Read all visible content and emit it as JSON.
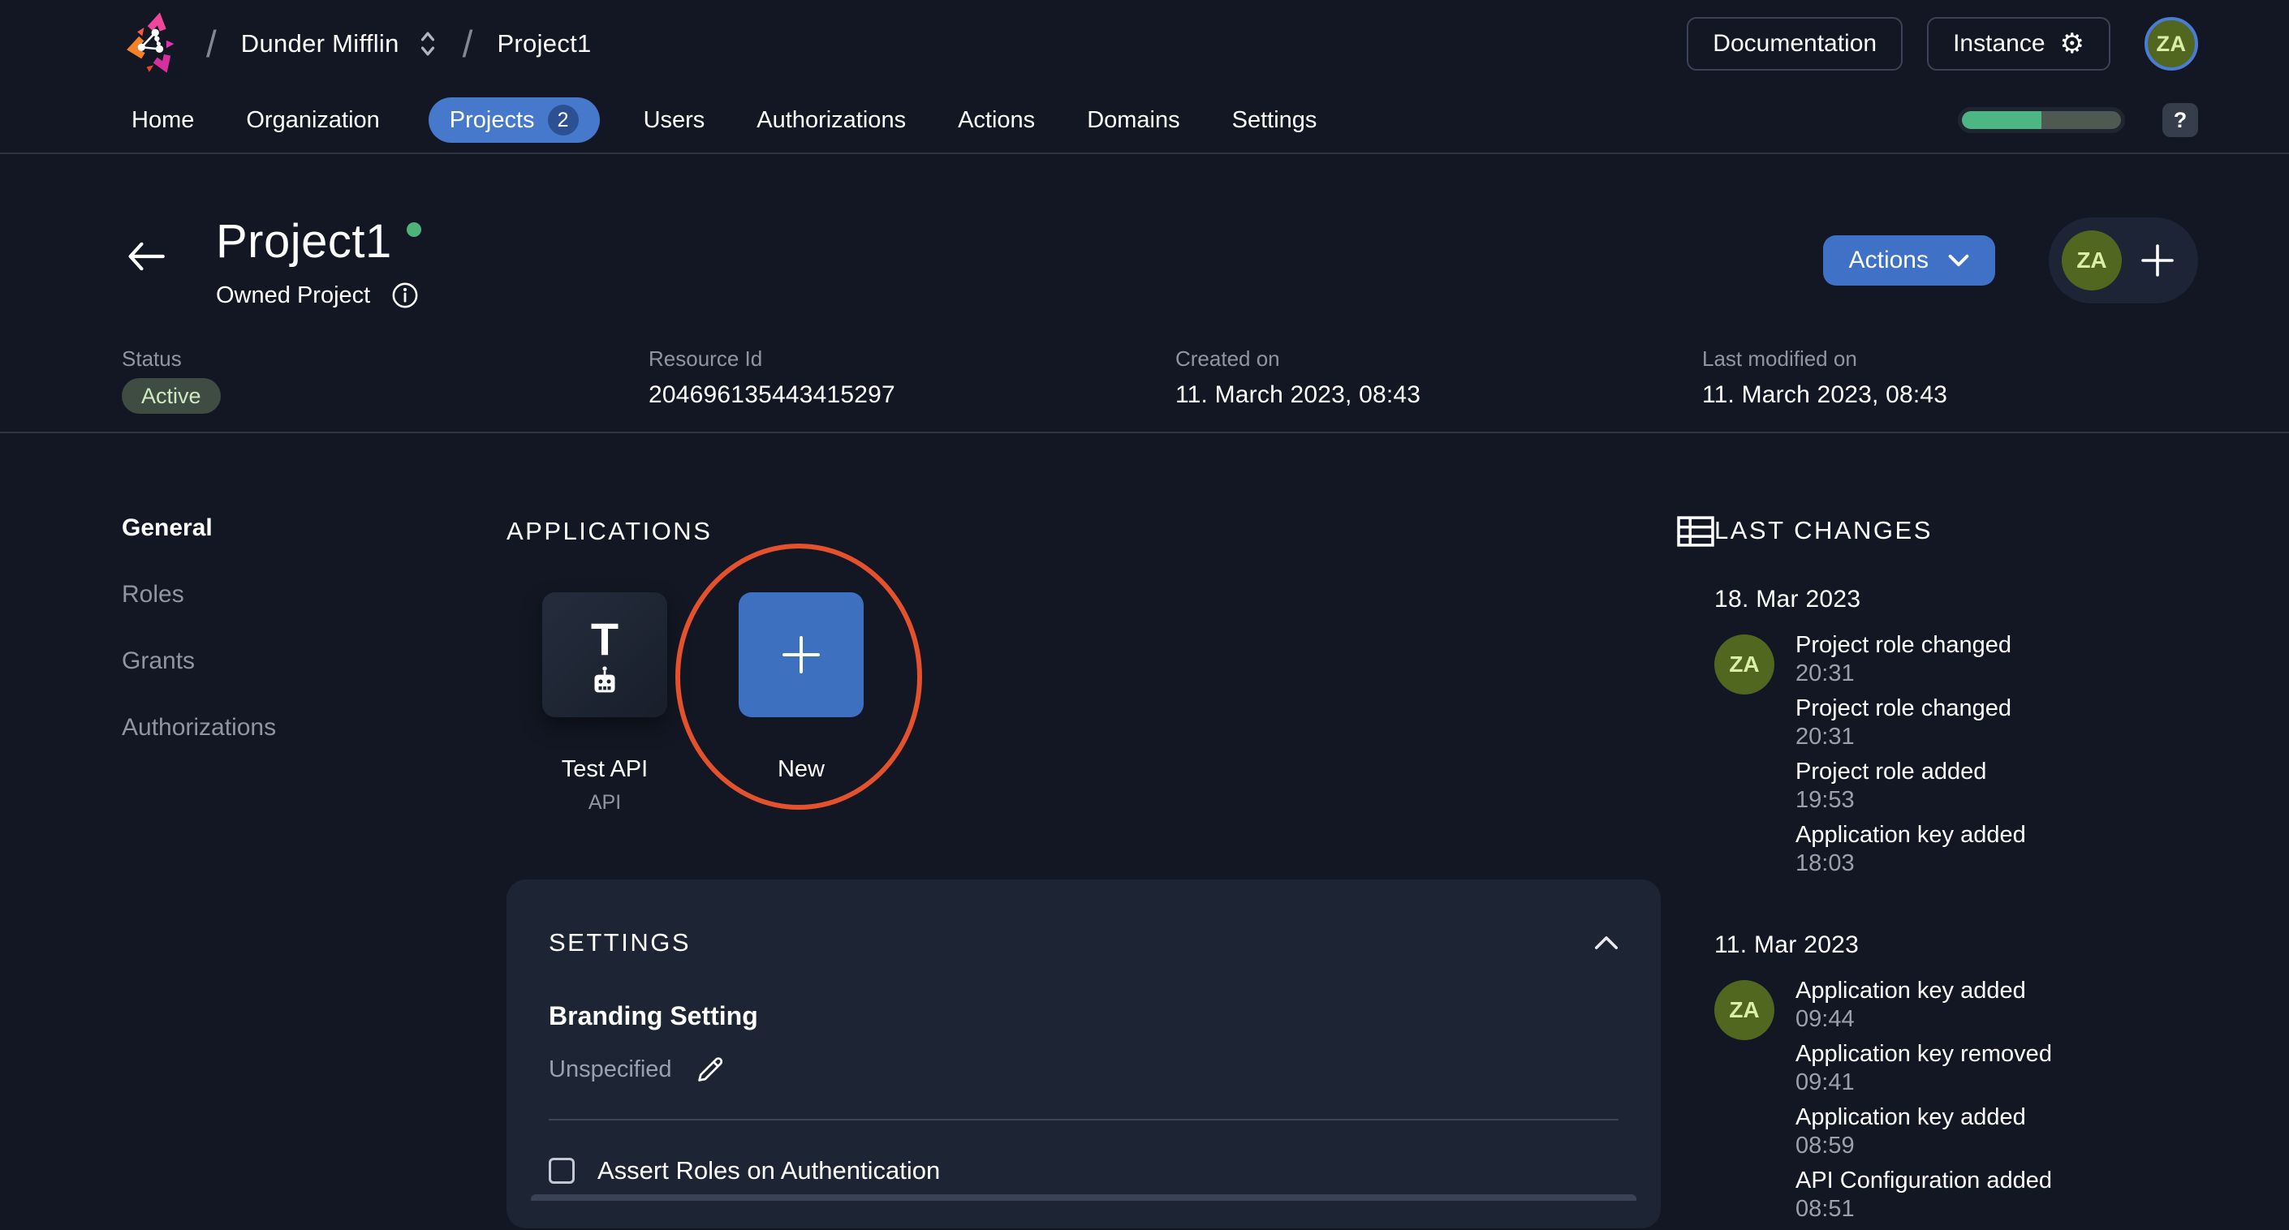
{
  "header": {
    "org_name": "Dunder Mifflin",
    "project_breadcrumb": "Project1",
    "documentation_label": "Documentation",
    "instance_label": "Instance",
    "avatar_initials": "ZA"
  },
  "nav": {
    "items": [
      {
        "label": "Home"
      },
      {
        "label": "Organization"
      },
      {
        "label": "Projects",
        "badge": "2",
        "active": true
      },
      {
        "label": "Users"
      },
      {
        "label": "Authorizations"
      },
      {
        "label": "Actions"
      },
      {
        "label": "Domains"
      },
      {
        "label": "Settings"
      }
    ],
    "progress_percent": 50,
    "help_label": "?"
  },
  "project": {
    "title": "Project1",
    "subtitle": "Owned Project",
    "actions_button_label": "Actions",
    "member_avatar_initials": "ZA"
  },
  "meta": {
    "columns": [
      {
        "label": "Status",
        "value": "Active"
      },
      {
        "label": "Resource Id",
        "value": "204696135443415297"
      },
      {
        "label": "Created on",
        "value": "11. March 2023, 08:43"
      },
      {
        "label": "Last modified on",
        "value": "11. March 2023, 08:43"
      }
    ]
  },
  "sidebar": {
    "items": [
      {
        "label": "General",
        "active": true
      },
      {
        "label": "Roles"
      },
      {
        "label": "Grants"
      },
      {
        "label": "Authorizations"
      }
    ]
  },
  "applications": {
    "section_title": "APPLICATIONS",
    "apps": [
      {
        "initial": "T",
        "name": "Test API",
        "type": "API"
      }
    ],
    "new_tile_label": "New"
  },
  "settings": {
    "section_title": "SETTINGS",
    "branding_label": "Branding Setting",
    "branding_value": "Unspecified",
    "assert_roles_label": "Assert Roles on Authentication",
    "assert_roles_checked": false
  },
  "last_changes": {
    "section_title": "LAST CHANGES",
    "groups": [
      {
        "date": "18. Mar 2023",
        "avatar_initials": "ZA",
        "events": [
          {
            "title": "Project role changed",
            "time": "20:31"
          },
          {
            "title": "Project role changed",
            "time": "20:31"
          },
          {
            "title": "Project role added",
            "time": "19:53"
          },
          {
            "title": "Application key added",
            "time": "18:03"
          }
        ]
      },
      {
        "date": "11. Mar 2023",
        "avatar_initials": "ZA",
        "events": [
          {
            "title": "Application key added",
            "time": "09:44"
          },
          {
            "title": "Application key removed",
            "time": "09:41"
          },
          {
            "title": "Application key added",
            "time": "08:59"
          },
          {
            "title": "API Configuration added",
            "time": "08:51"
          }
        ]
      }
    ]
  },
  "colors": {
    "accent_blue": "#4678cc",
    "status_green": "#4cb782",
    "avatar_olive": "#51671f",
    "annotation_red": "#e4512d"
  }
}
